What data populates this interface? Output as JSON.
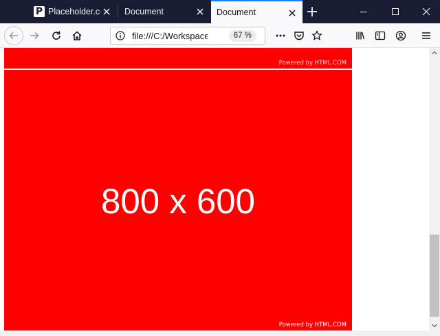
{
  "tabs": [
    {
      "label": "Placeholder.com",
      "favicon_letter": "P"
    },
    {
      "label": "Document"
    },
    {
      "label": "Document",
      "active": true
    }
  ],
  "toolbar": {
    "url": "file:///C:/Workspace",
    "zoom": "67 %"
  },
  "content": {
    "placeholder_top": {
      "powered": "Powered by HTML.COM"
    },
    "placeholder_main": {
      "dimensions": "800 x 600",
      "powered": "Powered by HTML.COM"
    },
    "placeholder_color": "#ff0000"
  },
  "colors": {
    "tabstrip": "#1a1c36",
    "active_tab_accent": "#0a84ff"
  }
}
